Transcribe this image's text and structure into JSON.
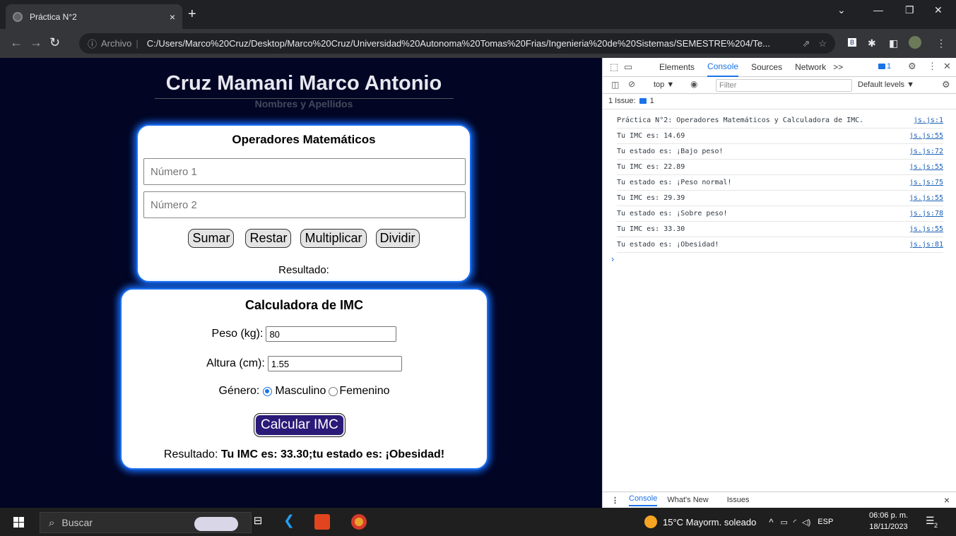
{
  "browser": {
    "tab_title": "Práctica N°2",
    "tab_close": "×",
    "new_tab": "+",
    "address_prefix": "Archivo",
    "url": "C:/Users/Marco%20Cruz/Desktop/Marco%20Cruz/Universidad%20Autonoma%20Tomas%20Frias/Ingenieria%20de%20Sistemas/SEMESTRE%204/Te..."
  },
  "page": {
    "name": "Cruz Mamani Marco Antonio",
    "name_subtitle": "Nombres y Apellidos",
    "math": {
      "title": "Operadores Matemáticos",
      "number1_placeholder": "Número 1",
      "number2_placeholder": "Número 2",
      "buttons": [
        "Sumar",
        "Restar",
        "Multiplicar",
        "Dividir"
      ],
      "result_label": "Resultado:"
    },
    "imc": {
      "title": "Calculadora de IMC",
      "weight_label": "Peso (kg):",
      "weight_value": "80",
      "height_label": "Altura (cm):",
      "height_value": "1.55",
      "gender_label": "Género:",
      "gender_options": [
        "Masculino",
        "Femenino"
      ],
      "gender_selected": "Masculino",
      "calc_button": "Calcular IMC",
      "result_label": "Resultado:",
      "result_value": "Tu IMC es: 33.30;tu estado es: ¡Obesidad!"
    }
  },
  "devtools": {
    "tabs": [
      "Elements",
      "Console",
      "Sources",
      "Network",
      ">>"
    ],
    "active_tab": "Console",
    "issue_badge": "1",
    "context": "top ▼",
    "filter_placeholder": "Filter",
    "levels": "Default levels ▼",
    "issues_label": "1 Issue:",
    "issues_count": "1",
    "logs": [
      {
        "msg": "Práctica N°2: Operadores Matemáticos y Calculadora de IMC.",
        "src": "js.js:1"
      },
      {
        "msg": "Tu IMC es: 14.69",
        "src": "js.js:55"
      },
      {
        "msg": "Tu estado es: ¡Bajo peso!",
        "src": "js.js:72"
      },
      {
        "msg": "Tu IMC es: 22.89",
        "src": "js.js:55"
      },
      {
        "msg": "Tu estado es: ¡Peso normal!",
        "src": "js.js:75"
      },
      {
        "msg": "Tu IMC es: 29.39",
        "src": "js.js:55"
      },
      {
        "msg": "Tu estado es: ¡Sobre peso!",
        "src": "js.js:78"
      },
      {
        "msg": "Tu IMC es: 33.30",
        "src": "js.js:55"
      },
      {
        "msg": "Tu estado es: ¡Obesidad!",
        "src": "js.js:81"
      }
    ],
    "prompt": "›",
    "drawer_tabs": [
      "Console",
      "What's New",
      "Issues"
    ],
    "drawer_close": "×"
  },
  "taskbar": {
    "search_placeholder": "Buscar",
    "weather": "15°C  Mayorm. soleado",
    "lang": "ESP",
    "time": "06:06 p. m.",
    "date": "18/11/2023",
    "notif_count": "2"
  },
  "colors": {
    "page_bg": "#020524",
    "card_glow": "#1670ff",
    "calc_button_bg": "#2b1a78",
    "devtools_accent": "#1a73e8"
  }
}
